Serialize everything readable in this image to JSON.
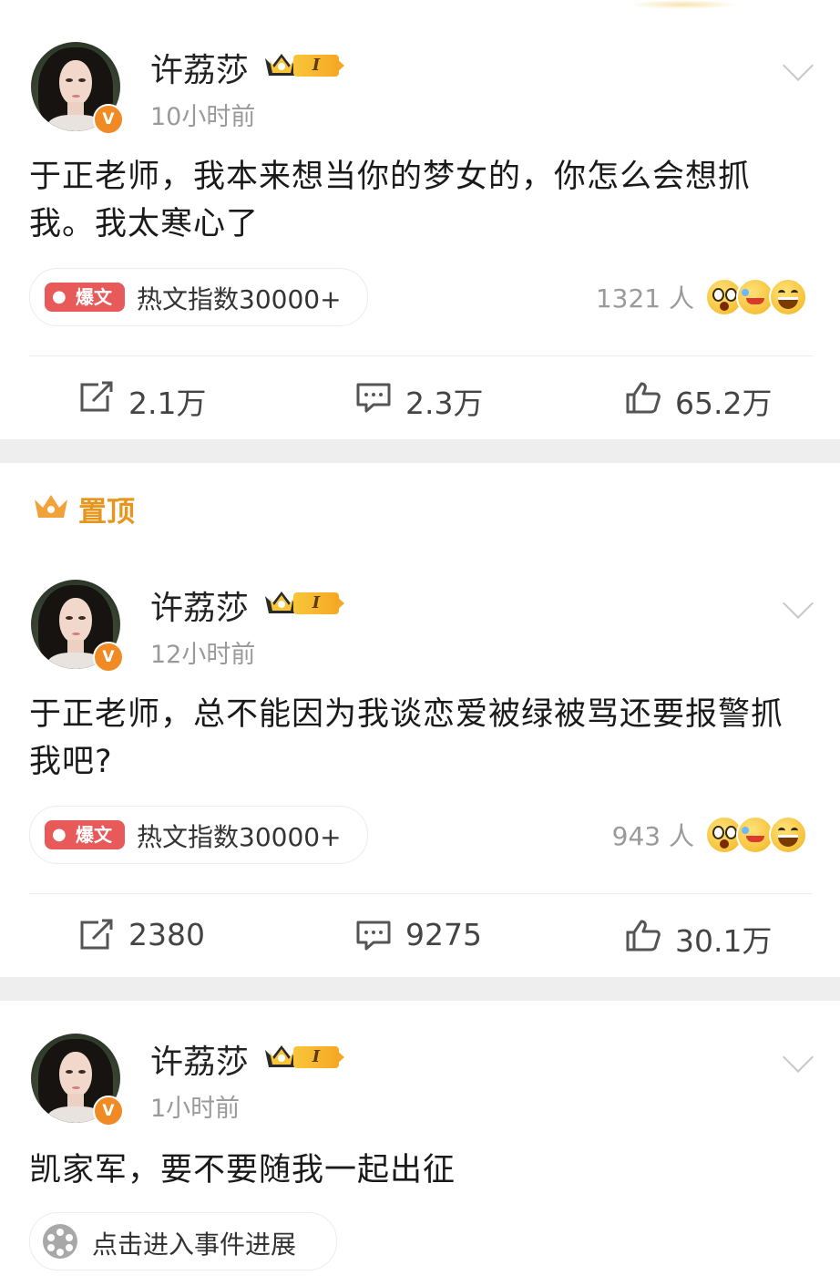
{
  "posts": [
    {
      "author": "许荔莎",
      "vip_level": "I",
      "verified_mark": "V",
      "time": "10小时前",
      "content": "于正老师，我本来想当你的梦女的，你怎么会想抓我。我太寒心了",
      "hot_badge": "爆文",
      "hot_text": "热文指数30000+",
      "reaction_count": "1321 人",
      "reposts": "2.1万",
      "comments": "2.3万",
      "likes": "65.2万"
    },
    {
      "pinned_label": "置顶",
      "author": "许荔莎",
      "vip_level": "I",
      "verified_mark": "V",
      "time": "12小时前",
      "content": "于正老师，总不能因为我谈恋爱被绿被骂还要报警抓我吧?",
      "hot_badge": "爆文",
      "hot_text": "热文指数30000+",
      "reaction_count": "943 人",
      "reposts": "2380",
      "comments": "9275",
      "likes": "30.1万"
    },
    {
      "author": "许荔莎",
      "vip_level": "I",
      "verified_mark": "V",
      "time": "1小时前",
      "content": "凯家军，要不要随我一起出征",
      "event_link": "点击进入事件进展"
    }
  ],
  "colors": {
    "accent_orange": "#f08a24",
    "pinned_gold": "#e8951c",
    "hot_red": "#e85a5a",
    "muted_text": "#9a9a9a"
  }
}
